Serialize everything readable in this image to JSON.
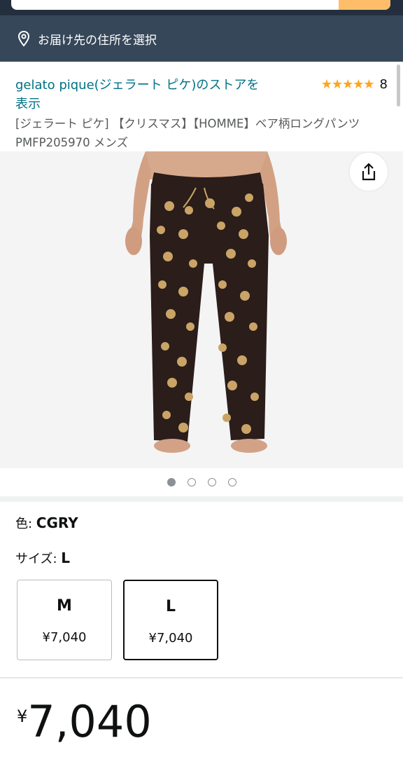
{
  "header": {
    "address_prompt": "お届け先の住所を選択"
  },
  "product": {
    "store_link": "gelato pique(ジェラート ピケ)のストアを表示",
    "rating_stars": "★★★★★",
    "rating_value": 5,
    "rating_count": "8",
    "title": "[ジェラート ピケ] 【クリスマス】【HOMME】ベア柄ロングパンツ PMFP205970 メンズ",
    "image_count": 4,
    "image_index": 1
  },
  "variants": {
    "color_label": "色: ",
    "color_value": "CGRY",
    "size_label": "サイズ: ",
    "size_value": "L",
    "sizes": [
      {
        "size": "M",
        "price": "¥7,040",
        "selected": false
      },
      {
        "size": "L",
        "price": "¥7,040",
        "selected": true
      }
    ]
  },
  "price": {
    "currency": "¥",
    "amount": "7,040"
  },
  "colors": {
    "header_dark": "#232f3e",
    "address_bar": "#37475a",
    "link": "#007185",
    "star": "#ffa41c",
    "pants": "#2a1d1a",
    "bear": "#caa466"
  },
  "icons": [
    "location-pin-icon",
    "share-icon",
    "star-icon"
  ]
}
